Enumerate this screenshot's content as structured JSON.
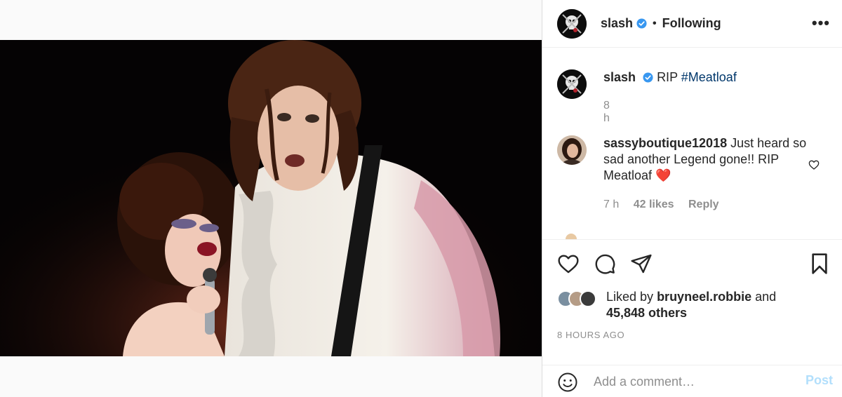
{
  "post": {
    "image_alt": "Two performers on stage: a man in a ruffled white shirt with suspenders and a woman singing into a microphone"
  },
  "header": {
    "username": "slash",
    "separator": "•",
    "follow_status": "Following",
    "more_icon": "more-horizontal-icon",
    "more_label": "•••"
  },
  "caption": {
    "username": "slash",
    "text": "RIP",
    "hashtag": "#Meatloaf",
    "age": "8 h"
  },
  "comments": [
    {
      "username": "sassyboutique12018",
      "text": "Just heard so sad another Legend gone!! RIP Meatloaf",
      "emoji": "❤️",
      "age": "7 h",
      "likes": "42 likes",
      "reply": "Reply"
    }
  ],
  "actions": {
    "like_icon": "heart-icon",
    "comment_icon": "comment-icon",
    "share_icon": "send-icon",
    "save_icon": "bookmark-icon"
  },
  "likes": {
    "prefix": "Liked by",
    "user": "bruyneel.robbie",
    "conjunction": "and",
    "others": "45,848 others"
  },
  "timestamp": "8 HOURS AGO",
  "comment_box": {
    "placeholder": "Add a comment…",
    "post_label": "Post"
  },
  "colors": {
    "verified": "#3897f0",
    "post_disabled": "#b2dffc",
    "muted": "#8e8e8e",
    "heart_red": "#ed4956"
  }
}
